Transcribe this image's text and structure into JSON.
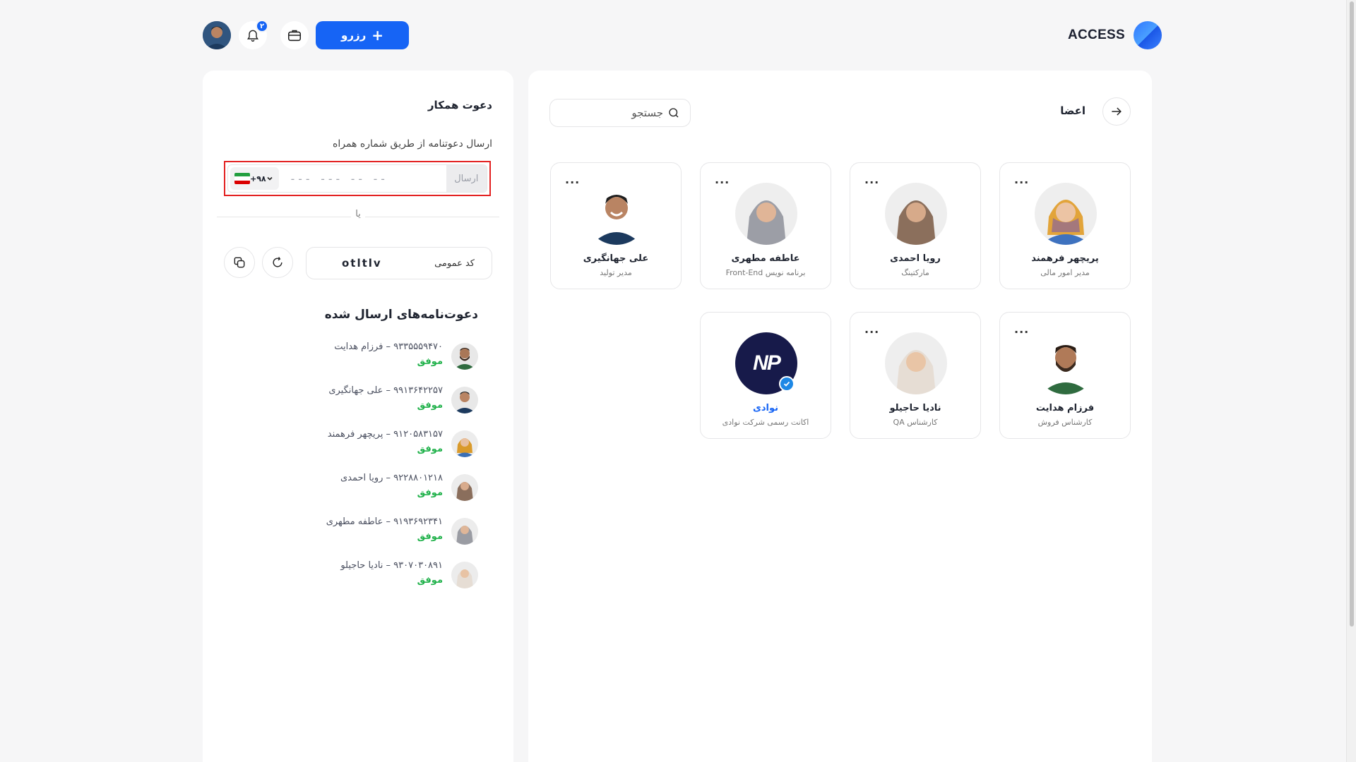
{
  "header": {
    "logo_text": "ACCESS",
    "reserve_label": "رزرو",
    "notification_count": "۲"
  },
  "invite": {
    "title": "دعوت همکار",
    "subtitle": "ارسال دعوتنامه از طریق شماره همراه",
    "country_code": "+۹۸",
    "phone_placeholder": "--- --- -- --",
    "send_label": "ارسال",
    "or_label": "یا",
    "public_code_label": "کد عمومی",
    "public_code_value": "otltlv",
    "sent_title": "دعوت‌نامه‌های ارسال شده",
    "sent_items": [
      {
        "line": "۹۳۳۵۵۵۹۴۷۰ – فرزام هدایت",
        "status": "موفق"
      },
      {
        "line": "۹۹۱۳۶۴۲۲۵۷ – علی جهانگیری",
        "status": "موفق"
      },
      {
        "line": "۹۱۲۰۵۸۳۱۵۷ – پریچهر فرهمند",
        "status": "موفق"
      },
      {
        "line": "۹۲۲۸۸۰۱۲۱۸ – رویا احمدی",
        "status": "موفق"
      },
      {
        "line": "۹۱۹۳۶۹۲۳۴۱ – عاطفه مطهری",
        "status": "موفق"
      },
      {
        "line": "۹۳۰۷۰۳۰۸۹۱ – نادیا حاجیلو",
        "status": "موفق"
      }
    ]
  },
  "members": {
    "title": "اعضا",
    "search_placeholder": "جستجو",
    "more_label": "...",
    "cards": [
      {
        "name": "پریچهر فرهمند",
        "role": "مدیر امور مالی"
      },
      {
        "name": "رویا احمدی",
        "role": "مارکتینگ"
      },
      {
        "name": "عاطفه مطهری",
        "role": "برنامه نویس Front-End"
      },
      {
        "name": "علی جهانگیری",
        "role": "مدیر تولید"
      },
      {
        "name": "فرزام هدایت",
        "role": "کارشناس فروش"
      },
      {
        "name": "نادیا حاجیلو",
        "role": "کارشناس QA"
      },
      {
        "name": "نوادی",
        "role": "اکانت رسمی شرکت نوادی",
        "logo_text": "NP"
      }
    ]
  },
  "colors": {
    "accent": "#1664f5",
    "success": "#22b24c",
    "highlight_border": "#e32222"
  }
}
